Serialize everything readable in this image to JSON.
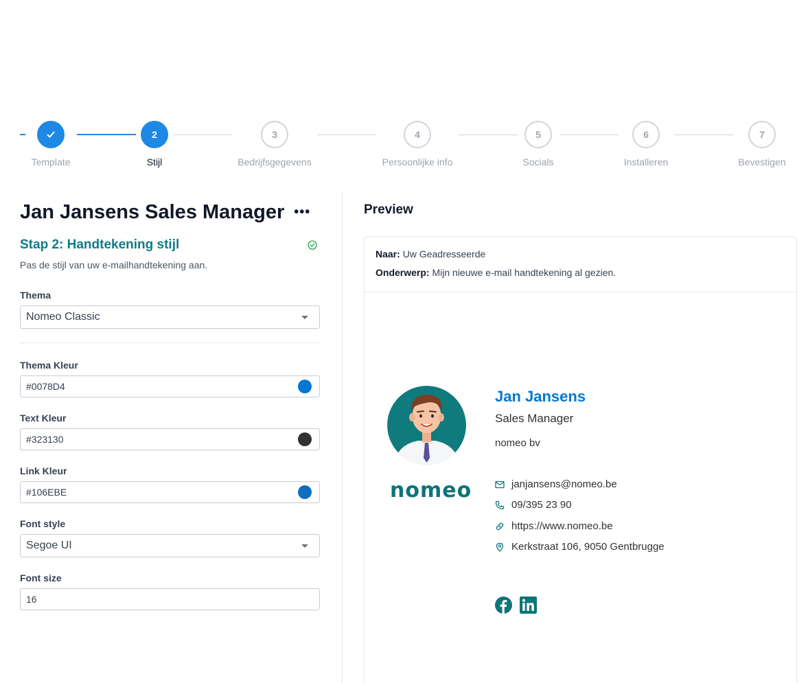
{
  "stepper": {
    "steps": [
      {
        "label": "Template",
        "number": "✓",
        "state": "done"
      },
      {
        "label": "Stijl",
        "number": "2",
        "state": "active"
      },
      {
        "label": "Bedrijfsgegevens",
        "number": "3",
        "state": "todo"
      },
      {
        "label": "Persoonlijke info",
        "number": "4",
        "state": "todo"
      },
      {
        "label": "Socials",
        "number": "5",
        "state": "todo"
      },
      {
        "label": "Installeren",
        "number": "6",
        "state": "todo"
      },
      {
        "label": "Bevestigen",
        "number": "7",
        "state": "todo"
      }
    ]
  },
  "editor": {
    "title": "Jan Jansens Sales Manager",
    "more_icon": "ellipsis-icon",
    "step_heading": "Stap 2: Handtekening stijl",
    "step_complete_icon": "check-circle-icon",
    "step_description": "Pas de stijl van uw e-mailhandtekening aan.",
    "theme": {
      "label": "Thema",
      "value": "Nomeo Classic"
    },
    "theme_color": {
      "label": "Thema Kleur",
      "value": "#0078D4",
      "swatch": "#0078d4"
    },
    "text_color": {
      "label": "Text Kleur",
      "value": "#323130",
      "swatch": "#323130"
    },
    "link_color": {
      "label": "Link Kleur",
      "value": "#106EBE",
      "swatch": "#106ebe"
    },
    "font_style": {
      "label": "Font style",
      "value": "Segoe UI"
    },
    "font_size": {
      "label": "Font size",
      "value": "16"
    }
  },
  "preview": {
    "title": "Preview",
    "to_label": "Naar:",
    "to_value": "Uw Geadresseerde",
    "subject_label": "Onderwerp:",
    "subject_value": "Mijn nieuwe e-mail handtekening al gezien.",
    "signature": {
      "name": "Jan Jansens",
      "role": "Sales Manager",
      "company": "nomeo bv",
      "logo_text": "nomeo",
      "email": "janjansens@nomeo.be",
      "phone": "09/395 23 90",
      "website": "https://www.nomeo.be",
      "address": "Kerkstraat 106, 9050 Gentbrugge",
      "socials": [
        "facebook-icon",
        "linkedin-icon"
      ]
    }
  },
  "colors": {
    "accent": "#1e88e5",
    "heading_teal": "#0e7c86",
    "logo_teal": "#0d7478"
  }
}
